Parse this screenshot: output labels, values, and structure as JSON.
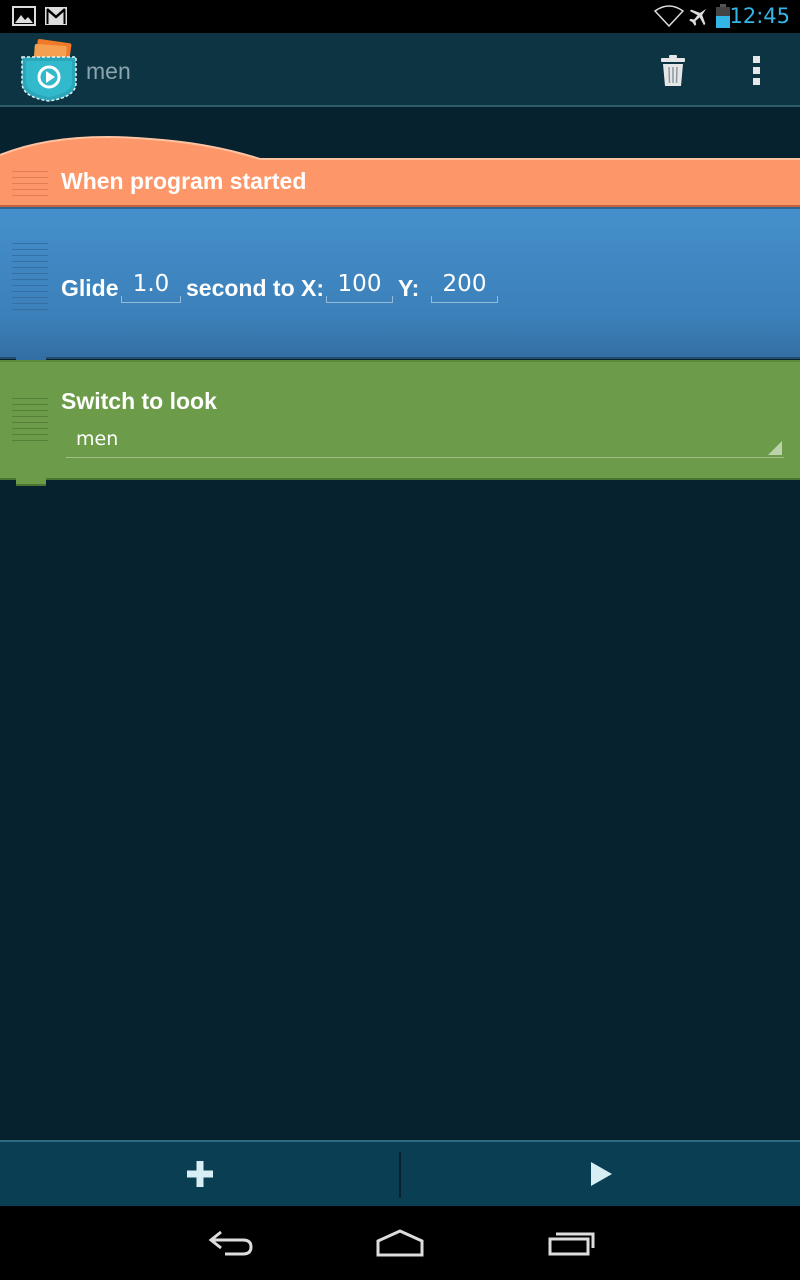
{
  "status_bar": {
    "time": "12:45",
    "icons": [
      "image-notification-icon",
      "gmail-icon",
      "wifi-icon",
      "airplane-mode-icon",
      "battery-icon"
    ]
  },
  "action_bar": {
    "title": "men",
    "app_icon": "pocket-code-icon",
    "actions": [
      "trash-icon",
      "overflow-menu-icon"
    ]
  },
  "colors": {
    "background": "#05222e",
    "event_brick": "#fd9769",
    "motion_brick": "#4590cc",
    "looks_brick": "#6c9c49",
    "accent": "#33b5e5"
  },
  "bricks": {
    "start": {
      "label": "When program started"
    },
    "glide": {
      "label_glide": "Glide",
      "seconds": "1.0",
      "label_second": "second to X:",
      "x": "100",
      "label_y": "Y:",
      "y": "200"
    },
    "look": {
      "label": "Switch to look",
      "selected": "men"
    }
  },
  "bottom_bar": {
    "add_icon": "plus-icon",
    "play_icon": "play-icon"
  },
  "nav_bar": {
    "icons": [
      "back-icon",
      "home-icon",
      "recent-apps-icon"
    ]
  }
}
